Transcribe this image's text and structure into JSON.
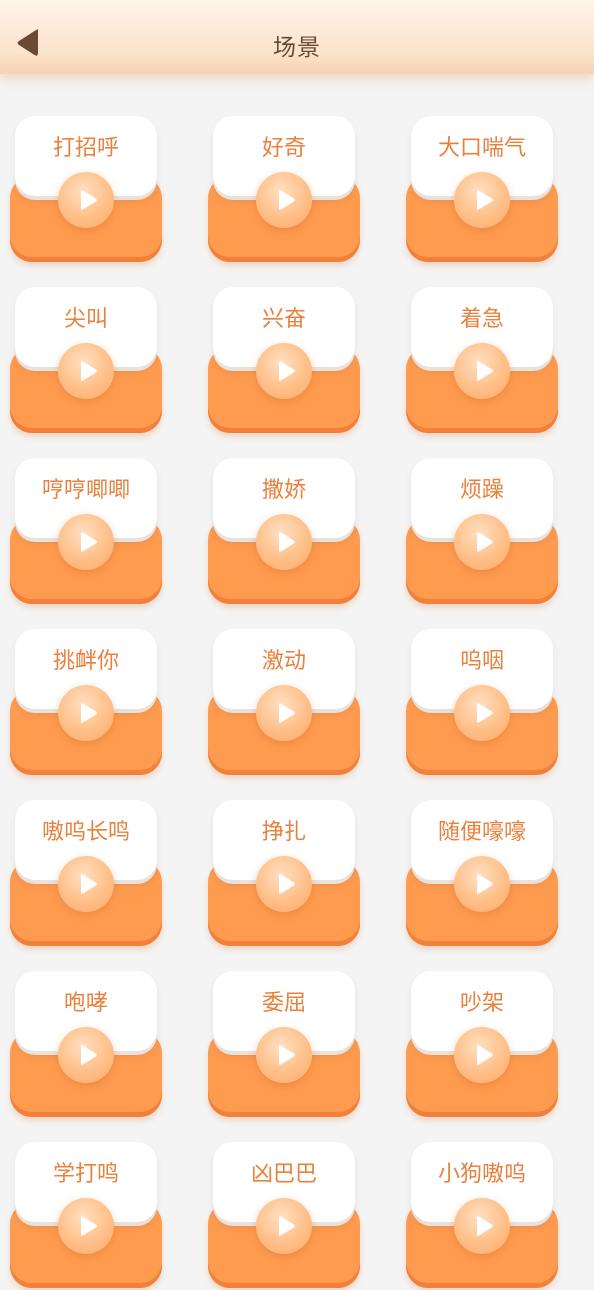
{
  "header": {
    "title": "场景",
    "back_icon": "back-arrow-icon"
  },
  "colors": {
    "accent": "#ff9b4f",
    "label": "#e8813e",
    "title": "#6b4a33"
  },
  "scenes": [
    {
      "label": "打招呼"
    },
    {
      "label": "好奇"
    },
    {
      "label": "大口喘气"
    },
    {
      "label": "尖叫"
    },
    {
      "label": "兴奋"
    },
    {
      "label": "着急"
    },
    {
      "label": "哼哼唧唧"
    },
    {
      "label": "撒娇"
    },
    {
      "label": "烦躁"
    },
    {
      "label": "挑衅你"
    },
    {
      "label": "激动"
    },
    {
      "label": "呜咽"
    },
    {
      "label": "嗷呜长鸣"
    },
    {
      "label": "挣扎"
    },
    {
      "label": "随便嚎嚎"
    },
    {
      "label": "咆哮"
    },
    {
      "label": "委屈"
    },
    {
      "label": "吵架"
    },
    {
      "label": "学打鸣"
    },
    {
      "label": "凶巴巴"
    },
    {
      "label": "小狗嗷呜"
    }
  ]
}
